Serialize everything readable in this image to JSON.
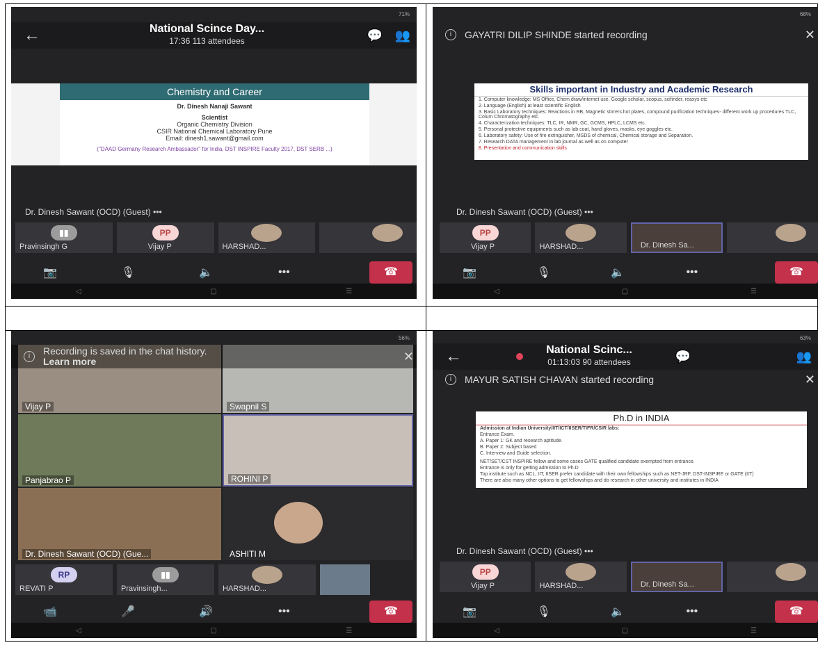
{
  "s1": {
    "battery": "71%",
    "title": "National Scince Day...",
    "subtitle": "17:36  113 attendees",
    "slide_title": "Chemistry and Career",
    "slide_lines": [
      "Dr. Dinesh Nanaji Sawant",
      "Scientist",
      "Organic Chemistry Division",
      "CSIR National Chemical Laboratory Pune",
      "Email: dinesh1.sawant@gmail.com",
      "(\"DAAD Germany Research Ambassador\" for India,  DST INSPIRE Faculty 2017,  DST SERB ...)"
    ],
    "speaker": "Dr. Dinesh Sawant (OCD) (Guest)  •••",
    "thumbs": [
      "Pravinsingh G",
      "Vijay P",
      "HARSHAD..."
    ],
    "av_pp": "PP"
  },
  "s2": {
    "battery": "68%",
    "notice": "GAYATRI DILIP SHINDE started recording",
    "slide_title": "Skills important in Industry and Academic Research",
    "items": [
      "1.  Computer knowledge: MS Office, Chem draw/internet use, Google scholar, scopus, scifinder, reaxys etc",
      "2.  Language (English) at least scientific English",
      "3.  Basic Laboratory techniques: Reactions in RB, Magnetic stirrers hot plates, compound purification techniques- different work up procedures TLC, Colum Chromatography etc.",
      "4.  Characterization techniques: TLC, IR, NMR, GC, GCMS, HPLC, LCMS etc.",
      "5.  Personal protective equipments such as lab coat, hand gloves, masks, eye goggles etc.",
      "6.  Laboratory safety: Use of fire extinguisher, MSDS of chemical, Chemical storage and Separation.",
      "7.  Research DATA management in lab journal as well as on computer",
      "8.  Presentation and communication skills"
    ],
    "speaker": "Dr. Dinesh Sawant (OCD) (Guest)  •••",
    "thumbs": [
      "Vijay P",
      "HARSHAD...",
      "Dr. Dinesh Sa..."
    ],
    "av_pp": "PP"
  },
  "s3": {
    "battery": "56%",
    "notice": "Recording is saved in the chat history.",
    "notice_link": "Learn more",
    "tiles": [
      "Vijay P",
      "Swapnil S",
      "Panjabrao P",
      "ROHINI P",
      "Dr. Dinesh Sawant (OCD) (Gue...",
      "ASHITI M"
    ],
    "thumbs": [
      "REVATI P",
      "Pravinsingh...",
      "HARSHAD..."
    ],
    "av_rp": "RP"
  },
  "s4": {
    "battery": "63%",
    "title": "National Scinc...",
    "subtitle": "01:13:03  90 attendees",
    "notice": "MAYUR SATISH CHAVAN started recording",
    "slide_title": "Ph.D in INDIA",
    "lines": [
      "Admission at Indian University/IIT/ICT/IISER/TIFR/CSIR labs:",
      "Entrance Exam.",
      "A.  Paper 1: GK and research aptitude.",
      "B.  Paper 2: Subject based",
      "C.  Interview  and Guide selection.",
      "NET/SET/CST INSPIRE fellow and some cases GATE qualified candidate exempted from entrance.",
      "Entrance is only for getting admission to Ph.D",
      "Top institute such as NCL, IIT, IISER prefer candidate with their own fellowships such as NET-JRF, DST-INSPIRE or GATE (IIT)",
      "There are also many other options to get fellowships and do research in other university and institutes in INDIA"
    ],
    "speaker": "Dr. Dinesh Sawant (OCD) (Guest)  •••",
    "thumbs": [
      "Vijay P",
      "HARSHAD...",
      "Dr. Dinesh Sa..."
    ],
    "av_pp": "PP"
  }
}
